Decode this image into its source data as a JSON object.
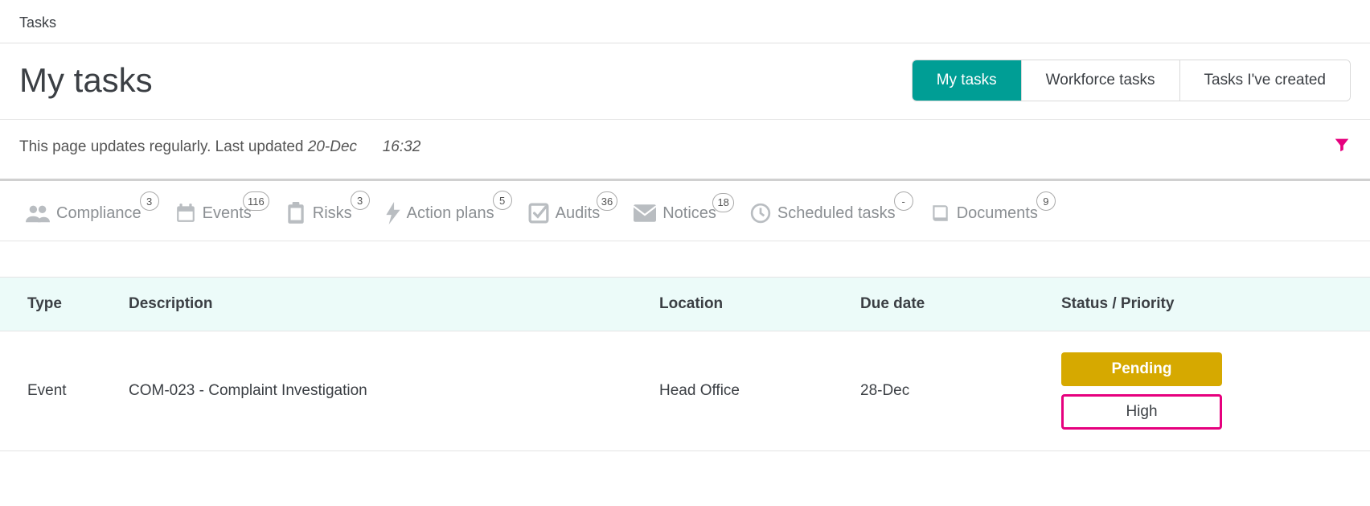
{
  "breadcrumb": "Tasks",
  "page_title": "My tasks",
  "scope_tabs": [
    {
      "label": "My tasks",
      "active": true
    },
    {
      "label": "Workforce tasks",
      "active": false
    },
    {
      "label": "Tasks I've created",
      "active": false
    }
  ],
  "update_line": {
    "prefix": "This page updates regularly. Last updated ",
    "date": "20-Dec",
    "time": "16:32"
  },
  "categories": [
    {
      "key": "compliance",
      "label": "Compliance",
      "count": "3",
      "icon": "users-icon"
    },
    {
      "key": "events",
      "label": "Events",
      "count": "116",
      "icon": "calendar-icon"
    },
    {
      "key": "risks",
      "label": "Risks",
      "count": "3",
      "icon": "clipboard-icon"
    },
    {
      "key": "action-plans",
      "label": "Action plans",
      "count": "5",
      "icon": "bolt-icon"
    },
    {
      "key": "audits",
      "label": "Audits",
      "count": "36",
      "icon": "check-square-icon"
    },
    {
      "key": "notices",
      "label": "Notices",
      "count": "18",
      "icon": "envelope-icon"
    },
    {
      "key": "scheduled-tasks",
      "label": "Scheduled tasks",
      "count": "-",
      "icon": "clock-icon"
    },
    {
      "key": "documents",
      "label": "Documents",
      "count": "9",
      "icon": "book-icon"
    }
  ],
  "table": {
    "headers": {
      "type": "Type",
      "description": "Description",
      "location": "Location",
      "due_date": "Due date",
      "status_priority": "Status / Priority"
    },
    "rows": [
      {
        "type": "Event",
        "description": "COM-023 - Complaint Investigation",
        "location": "Head Office",
        "due_date": "28-Dec",
        "status": "Pending",
        "priority": "High"
      }
    ]
  },
  "colors": {
    "accent_teal": "#009e95",
    "accent_pink": "#e6007e",
    "status_yellow": "#d6a900"
  }
}
